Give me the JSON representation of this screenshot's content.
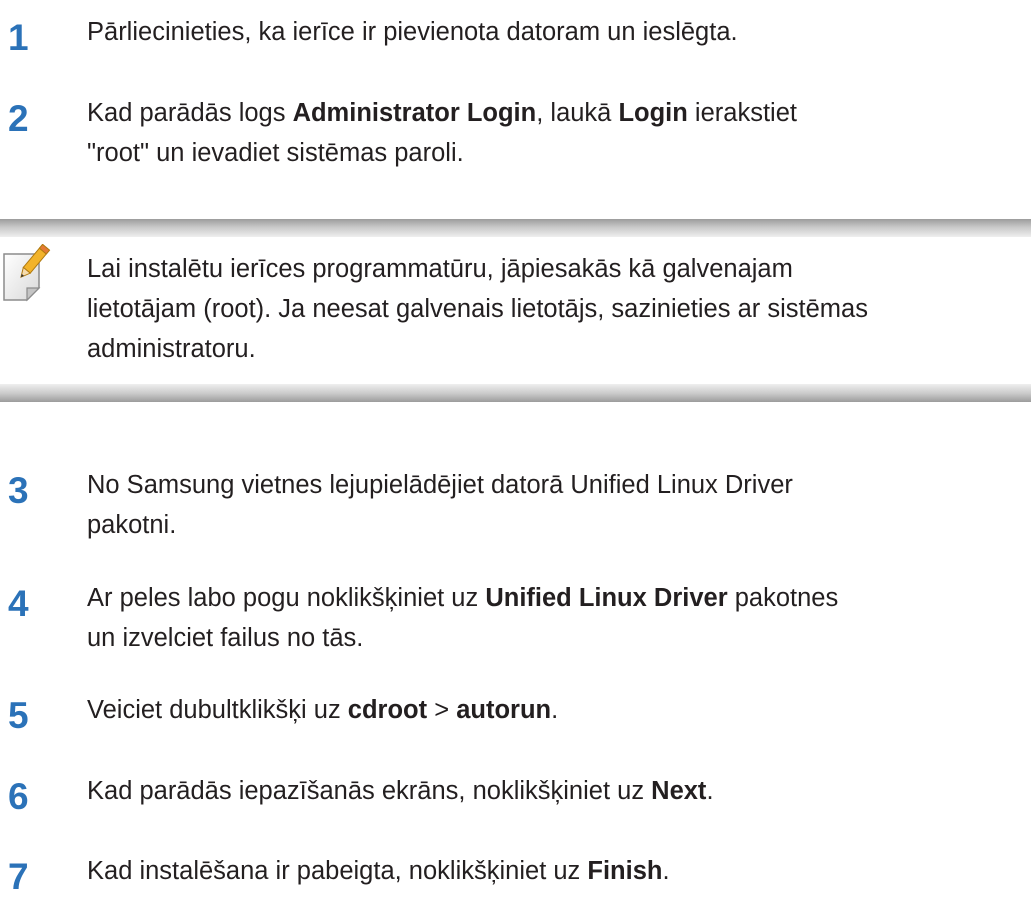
{
  "steps": [
    {
      "number": "1",
      "lines": [
        [
          {
            "text": "Pārliecinieties, ka ierīce ir pievienota datoram un ieslēgta.",
            "bold": false
          }
        ]
      ]
    },
    {
      "number": "2",
      "lines": [
        [
          {
            "text": "Kad parādās logs ",
            "bold": false
          },
          {
            "text": "Administrator Login",
            "bold": true
          },
          {
            "text": ", laukā ",
            "bold": false
          },
          {
            "text": "Login",
            "bold": true
          },
          {
            "text": " ierakstiet",
            "bold": false
          }
        ],
        [
          {
            "text": "\"root\" un ievadiet sistēmas paroli.",
            "bold": false
          }
        ]
      ]
    },
    {
      "number": "3",
      "lines": [
        [
          {
            "text": "No Samsung vietnes lejupielādējiet datorā Unified Linux Driver",
            "bold": false
          }
        ],
        [
          {
            "text": "pakotni.",
            "bold": false
          }
        ]
      ]
    },
    {
      "number": "4",
      "lines": [
        [
          {
            "text": "Ar peles labo pogu noklikšķiniet uz ",
            "bold": false
          },
          {
            "text": "Unified Linux Driver",
            "bold": true
          },
          {
            "text": " pakotnes",
            "bold": false
          }
        ],
        [
          {
            "text": "un izvelciet failus no tās.",
            "bold": false
          }
        ]
      ]
    },
    {
      "number": "5",
      "lines": [
        [
          {
            "text": "Veiciet dubultklikšķi uz ",
            "bold": false
          },
          {
            "text": "cdroot",
            "bold": true
          },
          {
            "text": " > ",
            "bold": false
          },
          {
            "text": "autorun",
            "bold": true
          },
          {
            "text": ".",
            "bold": false
          }
        ]
      ]
    },
    {
      "number": "6",
      "lines": [
        [
          {
            "text": "Kad parādās iepazīšanās ekrāns, noklikšķiniet uz ",
            "bold": false
          },
          {
            "text": "Next",
            "bold": true
          },
          {
            "text": ".",
            "bold": false
          }
        ]
      ]
    },
    {
      "number": "7",
      "lines": [
        [
          {
            "text": "Kad instalēšana ir pabeigta, noklikšķiniet uz ",
            "bold": false
          },
          {
            "text": "Finish",
            "bold": true
          },
          {
            "text": ".",
            "bold": false
          }
        ]
      ]
    }
  ],
  "note": {
    "icon": "note-pencil-icon",
    "lines": [
      "Lai instalētu ierīces programmatūru, jāpiesakās kā galvenajam",
      "lietotājam (root). Ja neesat galvenais lietotājs, sazinieties ar sistēmas",
      "administratoru."
    ]
  },
  "colors": {
    "step_number": "#2b72b8",
    "text": "#231f20",
    "note_rule": "#b5b5b5"
  }
}
